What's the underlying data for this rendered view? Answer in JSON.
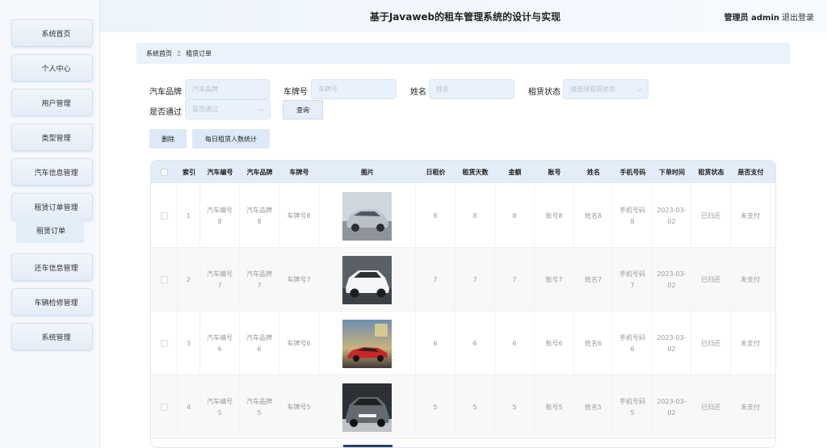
{
  "header": {
    "title": "基于Javaweb的租车管理系统的设计与实现",
    "user": "管理员 admin",
    "logout": "退出登录"
  },
  "sidebar": {
    "items": [
      {
        "label": "系统首页"
      },
      {
        "label": "个人中心"
      },
      {
        "label": "用户管理"
      },
      {
        "label": "类型管理"
      },
      {
        "label": "汽车信息管理"
      },
      {
        "label": "租赁订单管理"
      },
      {
        "label": "还车信息管理"
      },
      {
        "label": "车辆检修管理"
      },
      {
        "label": "系统管理"
      }
    ],
    "active_sub": "租赁订单"
  },
  "breadcrumb": {
    "home": "系统首页",
    "separator": "Ξ",
    "current": "租赁订单"
  },
  "search": {
    "brand_label": "汽车品牌",
    "brand_placeholder": "汽车品牌",
    "plate_label": "车牌号",
    "plate_placeholder": "车牌号",
    "name_label": "姓名",
    "name_placeholder": "姓名",
    "status_label": "租赁状态",
    "status_placeholder": "请选择租赁状态",
    "pass_label": "是否通过",
    "pass_placeholder": "是否通过",
    "query_button": "查询"
  },
  "actions": {
    "delete": "删除",
    "daily_stats": "每日租赁人数统计"
  },
  "table": {
    "columns": [
      "索引",
      "汽车编号",
      "汽车品牌",
      "车牌号",
      "图片",
      "日租价",
      "租赁天数",
      "金额",
      "账号",
      "姓名",
      "手机号码",
      "下单时间",
      "租赁状态",
      "是否支付"
    ],
    "rows": [
      {
        "index": "1",
        "car_no_a": "汽车编号",
        "car_no_b": "8",
        "brand_a": "汽车品牌",
        "brand_b": "8",
        "plate": "车牌号8",
        "image": "silver-sedan",
        "daily": "8",
        "days": "8",
        "amount": "8",
        "account": "账号8",
        "name": "姓名8",
        "phone_a": "手机号码",
        "phone_b": "8",
        "time_a": "2023-03-",
        "time_b": "02",
        "status": "已归还",
        "paid": "未支付"
      },
      {
        "index": "2",
        "car_no_a": "汽车编号",
        "car_no_b": "7",
        "brand_a": "汽车品牌",
        "brand_b": "7",
        "plate": "车牌号7",
        "image": "white-suv",
        "daily": "7",
        "days": "7",
        "amount": "7",
        "account": "账号7",
        "name": "姓名7",
        "phone_a": "手机号码",
        "phone_b": "7",
        "time_a": "2023-03-",
        "time_b": "02",
        "status": "已归还",
        "paid": "未支付"
      },
      {
        "index": "3",
        "car_no_a": "汽车编号",
        "car_no_b": "6",
        "brand_a": "汽车品牌",
        "brand_b": "6",
        "plate": "车牌号6",
        "image": "red-sports-car",
        "daily": "6",
        "days": "6",
        "amount": "6",
        "account": "账号6",
        "name": "姓名6",
        "phone_a": "手机号码",
        "phone_b": "6",
        "time_a": "2023-03-",
        "time_b": "02",
        "status": "已归还",
        "paid": "未支付"
      },
      {
        "index": "4",
        "car_no_a": "汽车编号",
        "car_no_b": "5",
        "brand_a": "汽车品牌",
        "brand_b": "5",
        "plate": "车牌号5",
        "image": "grey-suv",
        "daily": "5",
        "days": "5",
        "amount": "5",
        "account": "账号5",
        "name": "姓名5",
        "phone_a": "手机号码",
        "phone_b": "5",
        "time_a": "2023-03-",
        "time_b": "02",
        "status": "已归还",
        "paid": "未支付"
      }
    ]
  },
  "colors": {
    "accent": "#e3edf8",
    "sidebar_bg": "#f5f9fd",
    "text_muted": "#999999"
  }
}
